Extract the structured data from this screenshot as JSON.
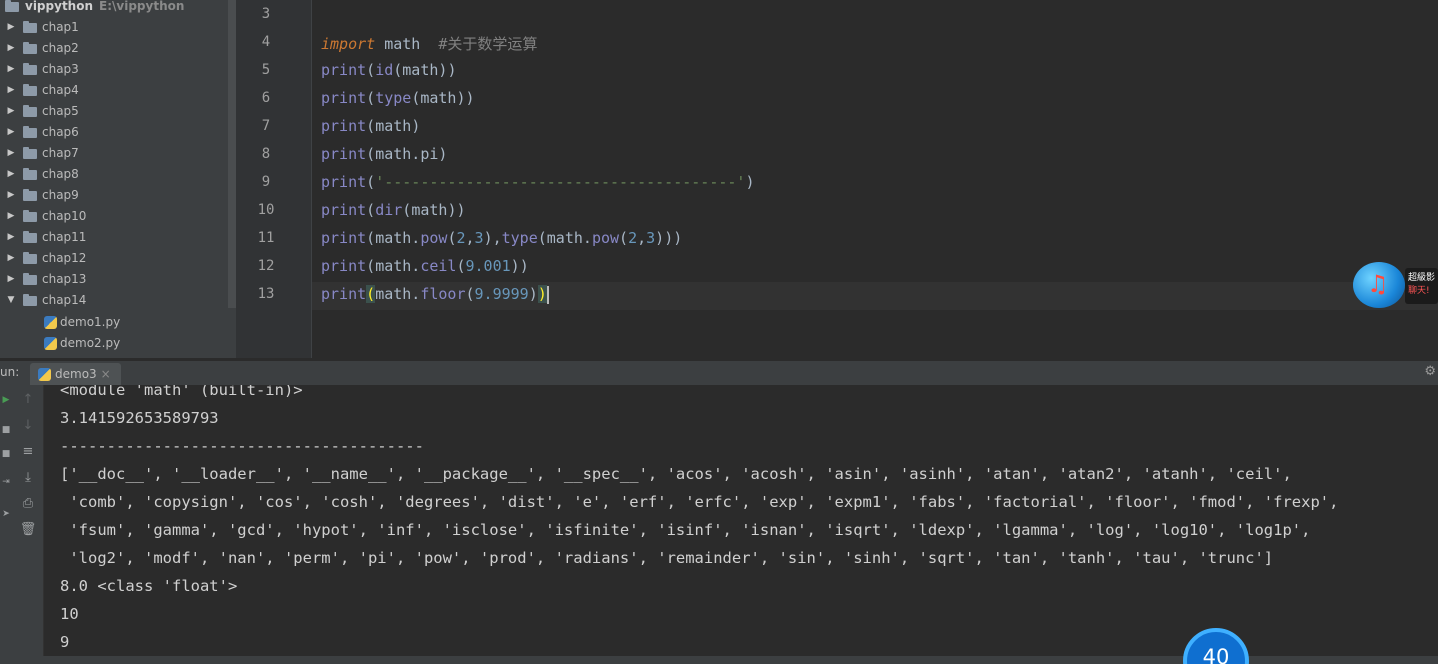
{
  "project": {
    "root_name": "vippython",
    "root_path": "E:\\vippython",
    "folders": [
      {
        "label": "chap1"
      },
      {
        "label": "chap2"
      },
      {
        "label": "chap3"
      },
      {
        "label": "chap4"
      },
      {
        "label": "chap5"
      },
      {
        "label": "chap6"
      },
      {
        "label": "chap7"
      },
      {
        "label": "chap8"
      },
      {
        "label": "chap9"
      },
      {
        "label": "chap10"
      },
      {
        "label": "chap11"
      },
      {
        "label": "chap12"
      },
      {
        "label": "chap13"
      },
      {
        "label": "chap14",
        "expanded": true
      }
    ],
    "files": [
      {
        "label": "demo1.py"
      },
      {
        "label": "demo2.py"
      }
    ]
  },
  "editor": {
    "line_numbers": [
      "3",
      "4",
      "5",
      "6",
      "7",
      "8",
      "9",
      "10",
      "11",
      "12",
      "13"
    ],
    "lines": {
      "l4_kw": "import",
      "l4_mod": " math  ",
      "l4_cmt": "#关于数学运算",
      "print": "print",
      "paren_open": "(",
      "paren_close": ")",
      "id": "id",
      "type": "type",
      "dir": "dir",
      "math": "math",
      "math_pi": "math.pi",
      "l9_str": "'---------------------------------------'",
      "math_dot": "math.",
      "pow": "pow",
      "ceil": "ceil",
      "floor": "floor",
      "n2": "2",
      "n3": "3",
      "comma": ",",
      "n9001": "9.001",
      "n99999": "9.9999"
    }
  },
  "float_badge": {
    "line1": "超級影",
    "line2": "聊天!"
  },
  "run": {
    "title": "un:",
    "tab_label": "demo3",
    "tab_close": "×",
    "output": [
      "<module 'math' (built-in)>",
      "3.141592653589793",
      "---------------------------------------",
      "['__doc__', '__loader__', '__name__', '__package__', '__spec__', 'acos', 'acosh', 'asin', 'asinh', 'atan', 'atan2', 'atanh', 'ceil',",
      " 'comb', 'copysign', 'cos', 'cosh', 'degrees', 'dist', 'e', 'erf', 'erfc', 'exp', 'expm1', 'fabs', 'factorial', 'floor', 'fmod', 'frexp',",
      " 'fsum', 'gamma', 'gcd', 'hypot', 'inf', 'isclose', 'isfinite', 'isinf', 'isnan', 'isqrt', 'ldexp', 'lgamma', 'log', 'log10', 'log1p',",
      " 'log2', 'modf', 'nan', 'perm', 'pi', 'pow', 'prod', 'radians', 'remainder', 'sin', 'sinh', 'sqrt', 'tan', 'tanh', 'tau', 'trunc']",
      "8.0 <class 'float'>",
      "10",
      "9"
    ]
  },
  "progress_badge": "40"
}
